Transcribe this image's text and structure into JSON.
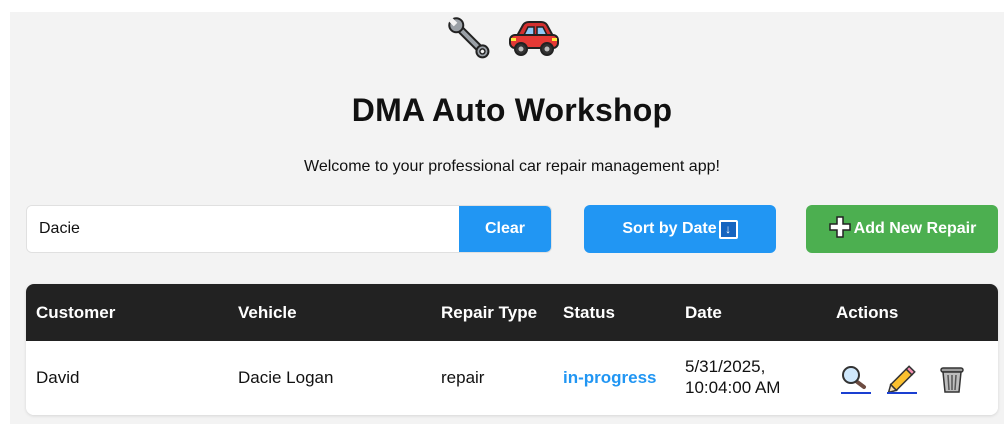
{
  "header": {
    "icons": [
      "wrench-icon",
      "car-icon"
    ],
    "title": "DMA Auto Workshop",
    "subtitle": "Welcome to your professional car repair management app!"
  },
  "search": {
    "value": "Dacie",
    "clear_label": "Clear"
  },
  "toolbar": {
    "sort_label": "Sort by Date",
    "sort_icon": "↓",
    "add_label": "Add New Repair"
  },
  "table": {
    "columns": [
      "Customer",
      "Vehicle",
      "Repair Type",
      "Status",
      "Date",
      "Actions"
    ],
    "rows": [
      {
        "customer": "David",
        "vehicle": "Dacie Logan",
        "repair_type": "repair",
        "status": "in-progress",
        "date_line1": "5/31/2025,",
        "date_line2": "10:04:00 AM",
        "actions": [
          "magnifier-icon",
          "pencil-icon",
          "trash-icon"
        ]
      }
    ]
  },
  "colors": {
    "accent_blue": "#2196f3",
    "add_green": "#4caf50",
    "table_header": "#222222"
  }
}
